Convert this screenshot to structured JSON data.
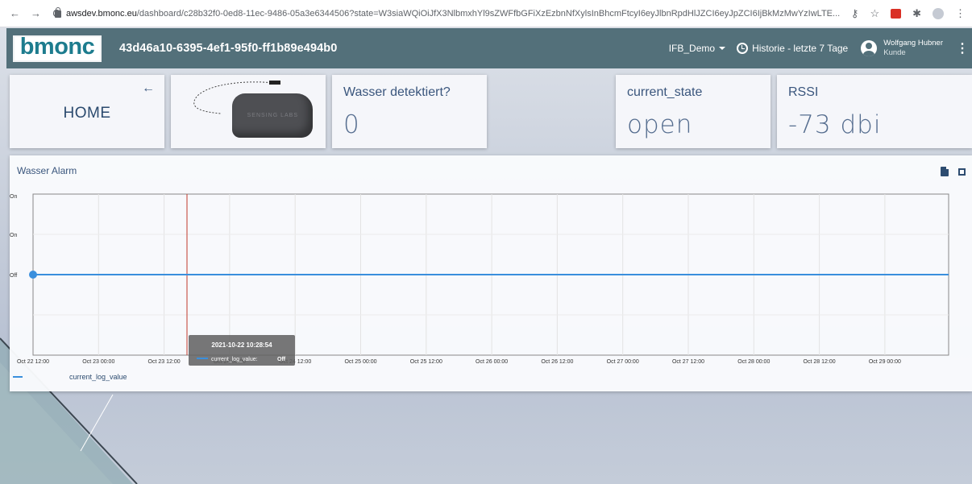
{
  "browser": {
    "back_glyph": "←",
    "forward_glyph": "→",
    "reload_glyph": "C",
    "url_host": "awsdev.bmonc.eu",
    "url_path": "/dashboard/c28b32f0-0ed8-11ec-9486-05a3e6344506?state=W3siaWQiOiJfX3NlbmxhYl9sZWFfbGFiXzEzbnNfXylsInBhcmFtcyI6eyJlbnRpdHlJZCI6eyJpZCI6IjBkMzMwYzIwLTE..."
  },
  "toolbar": {
    "logo_text": "bmonc",
    "entity_id": "43d46a10-6395-4ef1-95f0-ff1b89e494b0",
    "dashboard_select": "IFB_Demo",
    "timewindow": "Historie - letzte 7 Tage",
    "user_name": "Wolfgang Hubner",
    "user_role": "Kunde",
    "menu_glyph": "⋮"
  },
  "cards": {
    "home": {
      "label": "HOME",
      "back_glyph": "←"
    },
    "sensor_image": {
      "brand_text": "SENSING LABS"
    },
    "water": {
      "title": "Wasser detektiert?",
      "value": "0"
    },
    "state": {
      "title": "current_state",
      "value": "open"
    },
    "rssi": {
      "title": "RSSI",
      "value": "-73 dbi"
    }
  },
  "chart_panel": {
    "title": "Wasser Alarm",
    "legend_label": "current_log_value"
  },
  "chart_data": {
    "type": "line",
    "title": "Wasser Alarm",
    "xlabel": "",
    "ylabel": "",
    "x_ticks": [
      "Oct 22 12:00",
      "Oct 23 00:00",
      "Oct 23 12:00",
      "Oct 24 00:00",
      "Oct 24 12:00",
      "Oct 25 00:00",
      "Oct 25 12:00",
      "Oct 26 00:00",
      "Oct 26 12:00",
      "Oct 27 00:00",
      "Oct 27 12:00",
      "Oct 28 00:00",
      "Oct 28 12:00",
      "Oct 29 00:00"
    ],
    "y_ticks": [
      "On",
      "On",
      "Off"
    ],
    "series": [
      {
        "name": "current_log_value",
        "color": "#3a8fdd",
        "values_label": "Off",
        "x": [
          "2021-10-22 10:28:54",
          "2021-10-29 10:28:54"
        ],
        "y": [
          0,
          0
        ]
      }
    ],
    "grid": true,
    "legend": "bottom-left",
    "crosshair_x": "2021-10-22 10:28:54",
    "tooltip": {
      "time": "2021-10-22 10:28:54",
      "series": "current_log_value",
      "value": "Off"
    }
  }
}
